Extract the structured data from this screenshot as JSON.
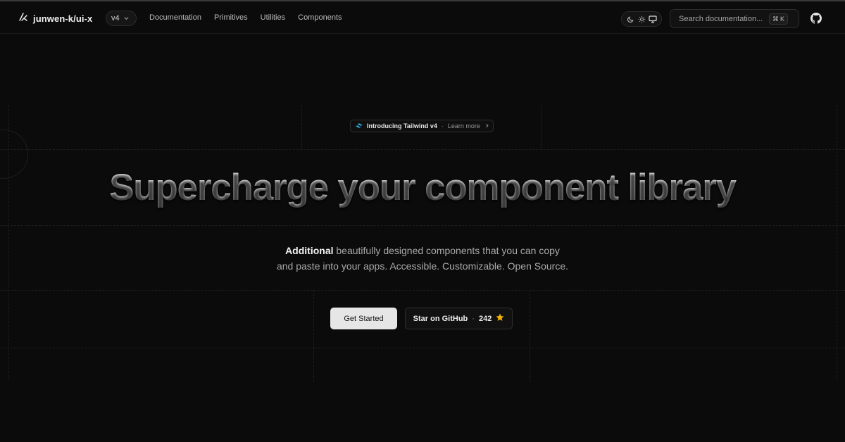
{
  "header": {
    "brand": "junwen-k/ui-x",
    "version": "v4",
    "nav": [
      {
        "label": "Documentation"
      },
      {
        "label": "Primitives"
      },
      {
        "label": "Utilities"
      },
      {
        "label": "Components"
      }
    ],
    "search": {
      "placeholder": "Search documentation...",
      "shortcut_symbol": "⌘",
      "shortcut_key": "K"
    },
    "theme_options": [
      "moon-icon",
      "sun-icon",
      "monitor-icon"
    ],
    "github_icon": "github-icon"
  },
  "badge": {
    "main": "Introducing Tailwind v4",
    "separator": "·",
    "link": "Learn more",
    "icon": "tailwind-icon"
  },
  "hero": {
    "title": "Supercharge your component library",
    "subtitle_strong": "Additional",
    "subtitle_line1": " beautifully designed components that you can copy",
    "subtitle_line2": "and paste into your apps. Accessible. Customizable. Open Source."
  },
  "actions": {
    "primary": "Get Started",
    "secondary": "Star on GitHub",
    "separator": "·",
    "stars": "242"
  },
  "colors": {
    "background": "#0b0b0b",
    "primary_button": "#e6e6e6",
    "star": "#f5b301",
    "tailwind": "#38bdf8"
  }
}
